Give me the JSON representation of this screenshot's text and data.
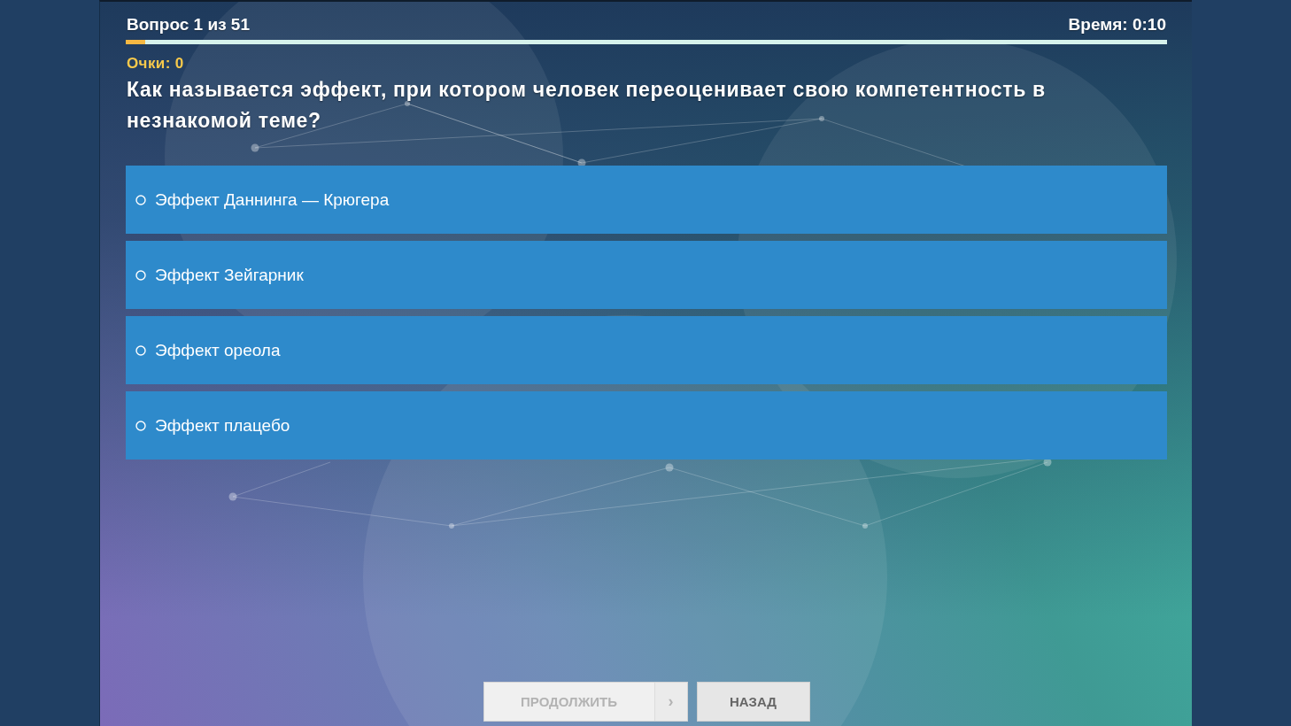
{
  "header": {
    "question_counter": "Вопрос 1 из 51",
    "timer": "Время: 0:10"
  },
  "progress": {
    "level": 0.019
  },
  "score": "Очки: 0",
  "question": "Как называется эффект, при котором человек переоценивает свою компетентность в незнакомой теме?",
  "options": [
    {
      "label": "Эффект Даннинга — Крюгера",
      "selected": false
    },
    {
      "label": "Эффект Зейгарник",
      "selected": false
    },
    {
      "label": "Эффект ореола",
      "selected": false
    },
    {
      "label": "Эффект плацебо",
      "selected": false
    }
  ],
  "buttons": [
    {
      "kind": "continue",
      "label": "ПРОДОЛЖИТЬ",
      "arrow": "›",
      "disabled": true
    },
    {
      "kind": "back",
      "label": "НАЗАД",
      "disabled": false
    }
  ]
}
